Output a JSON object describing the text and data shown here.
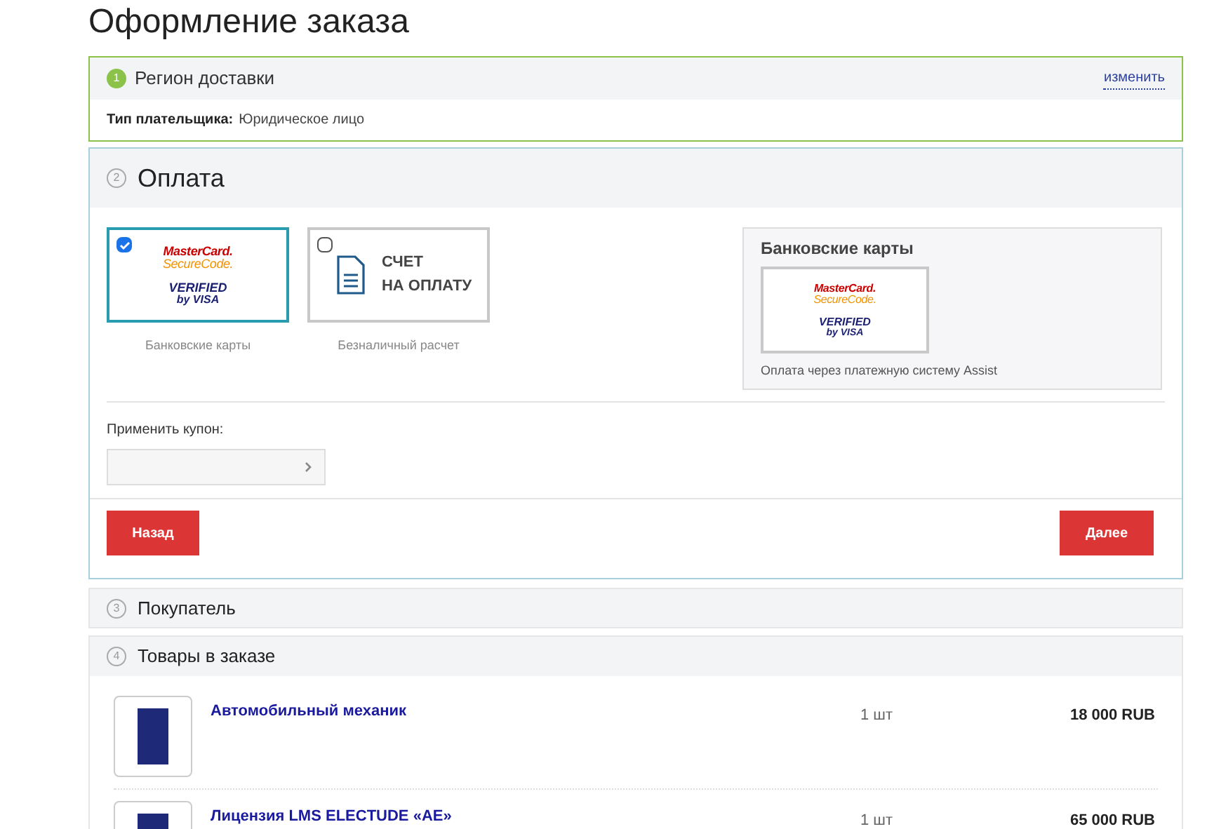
{
  "page_title": "Оформление заказа",
  "region": {
    "step": "1",
    "title": "Регион доставки",
    "done": true,
    "change_link": "изменить",
    "payer_label": "Тип плательщика:",
    "payer_value": "Юридическое лицо"
  },
  "payment": {
    "step": "2",
    "title": "Оплата",
    "methods": [
      {
        "kind": "cards",
        "selected": true,
        "caption": "Банковские карты",
        "logo": {
          "mc_top": "MasterCard.",
          "mc_bottom": "SecureCode.",
          "visa_top": "VERIFIED",
          "visa_bottom": "by VISA"
        }
      },
      {
        "kind": "invoice",
        "selected": false,
        "caption": "Безналичный расчет",
        "lines": [
          "СЧЕТ",
          "НА ОПЛАТУ"
        ]
      }
    ],
    "details": {
      "title": "Банковские карты",
      "logo": {
        "mc_top": "MasterCard.",
        "mc_bottom": "SecureCode.",
        "visa_top": "VERIFIED",
        "visa_bottom": "by VISA"
      },
      "description": "Оплата через платежную систему Assist"
    },
    "coupon_label": "Применить купон:",
    "back_button": "Назад",
    "next_button": "Далее"
  },
  "buyer": {
    "step": "3",
    "title": "Покупатель"
  },
  "goods": {
    "step": "4",
    "title": "Товары в заказе",
    "items": [
      {
        "name": "Автомобильный механик",
        "qty": "1 шт",
        "price": "18 000 RUB"
      },
      {
        "name": "Лицензия LMS ELECTUDE «AE»",
        "qty": "1 шт",
        "price": "65 000 RUB"
      }
    ]
  }
}
